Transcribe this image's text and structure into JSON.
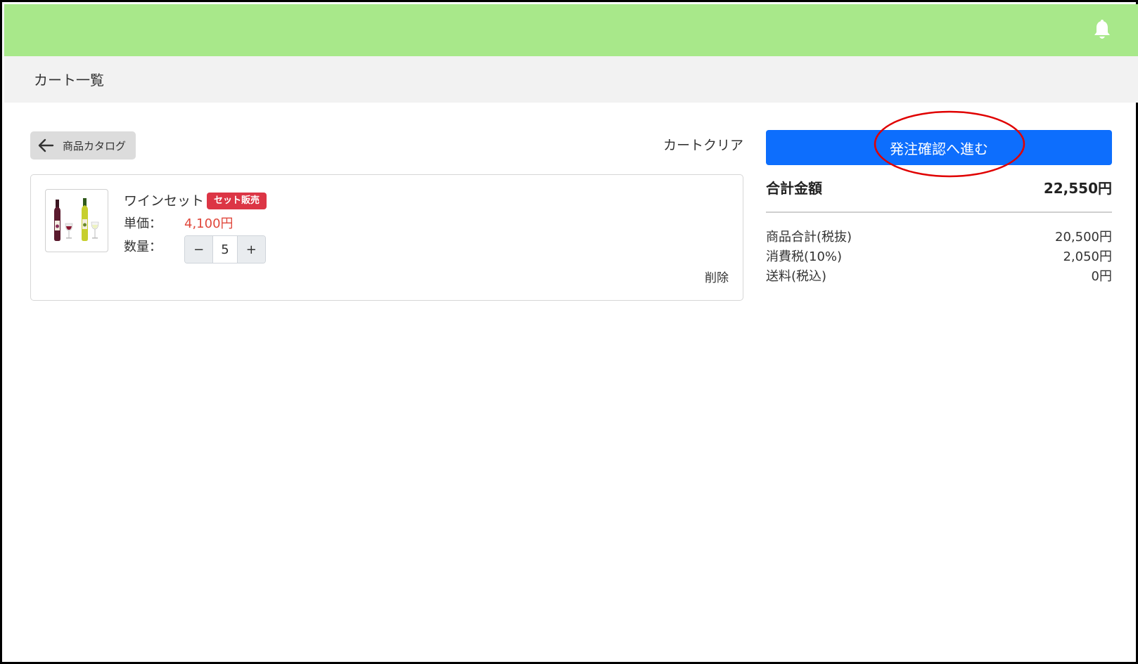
{
  "header": {
    "notification_icon": "bell-icon",
    "background": "#a8e88a"
  },
  "page": {
    "title": "カート一覧"
  },
  "toolbar": {
    "back_label": "商品カタログ",
    "back_icon": "arrow-left-icon",
    "clear_label": "カートクリア"
  },
  "cart": {
    "items": [
      {
        "name": "ワインセット",
        "badge": "セット販売",
        "unit_price_label": "単価：",
        "unit_price": "4,100円",
        "quantity_label": "数量：",
        "quantity": "5",
        "decrement": "−",
        "increment": "+",
        "delete_label": "削除",
        "image": "wine-bottles-image"
      }
    ]
  },
  "summary": {
    "order_button": "発注確認へ進む",
    "total_label": "合計金額",
    "total_value": "22,550円",
    "rows": [
      {
        "label": "商品合計(税抜)",
        "value": "20,500円"
      },
      {
        "label": "消費税(10%)",
        "value": "2,050円"
      },
      {
        "label": "送料(税込)",
        "value": "0円"
      }
    ]
  },
  "colors": {
    "primary": "#0d6efd",
    "badge": "#dc3545",
    "price": "#e0473b",
    "annotation": "#e00000"
  }
}
